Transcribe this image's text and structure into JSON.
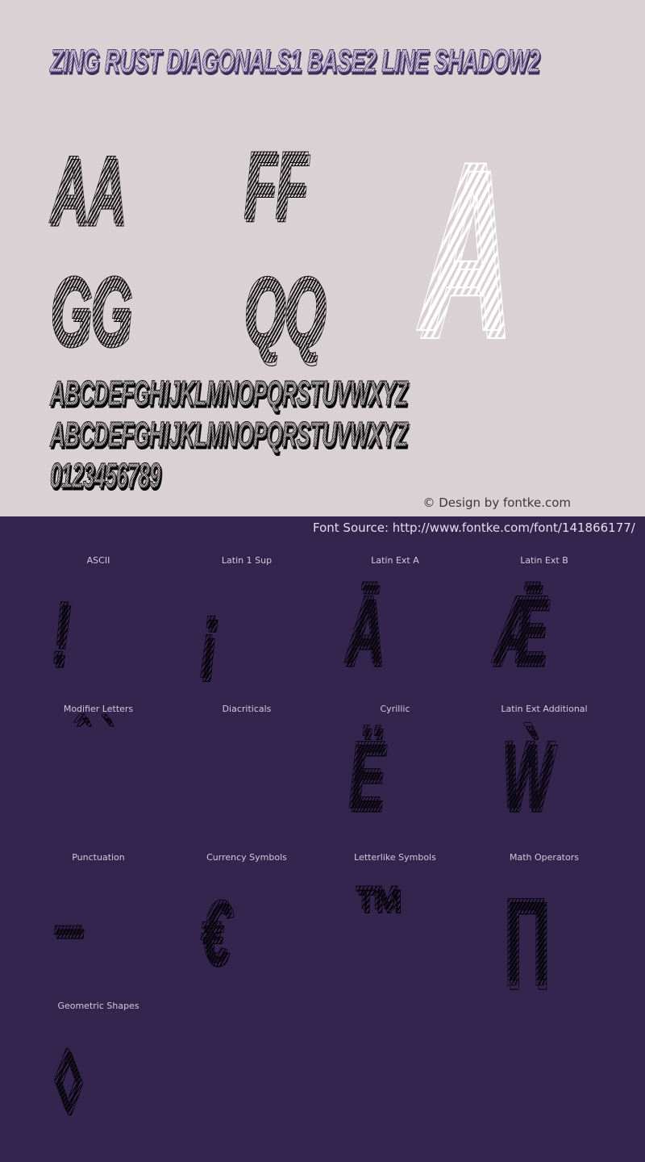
{
  "font_preview": {
    "title": "Zing Rust Diagonals1 Base2 Line Shadow2",
    "sample_pairs": [
      "AA",
      "FF",
      "GG",
      "QQ"
    ],
    "hero_glyph": "A",
    "uppercase_line": "ABCDEFGHIJKLMNOPQRSTUVWXYZ",
    "lowercase_line": "abcdefghijklmnopqrstuvwxyz",
    "digits_line": "0123456789",
    "credit": "© Design by fontke.com",
    "source": "Font Source: http://www.fontke.com/font/141866177/"
  },
  "colors": {
    "top_background": "#d9d1d3",
    "bottom_background": "#33254d",
    "title_shadow": "#3b2a58",
    "glyph_ink": "#0b0714",
    "hero_glyph_color": "#ffffff",
    "label_text": "#d2cbdc"
  },
  "charsets": [
    {
      "label": "ASCII",
      "glyph": "!"
    },
    {
      "label": "Latin 1 Sup",
      "glyph": "¡"
    },
    {
      "label": "Latin Ext A",
      "glyph": "Ā"
    },
    {
      "label": "Latin Ext B",
      "glyph": "Ǣ"
    },
    {
      "label": "Modifier Letters",
      "glyph": "ˆ ˋ"
    },
    {
      "label": "Diacriticals",
      "glyph": ""
    },
    {
      "label": "Cyrillic",
      "glyph": "Ё"
    },
    {
      "label": "Latin Ext Additional",
      "glyph": "Ẁ"
    },
    {
      "label": "Punctuation",
      "glyph": "–"
    },
    {
      "label": "Currency Symbols",
      "glyph": "€"
    },
    {
      "label": "Letterlike Symbols",
      "glyph": "™"
    },
    {
      "label": "Math Operators",
      "glyph": "∏"
    },
    {
      "label": "Geometric Shapes",
      "glyph": "◊"
    }
  ]
}
